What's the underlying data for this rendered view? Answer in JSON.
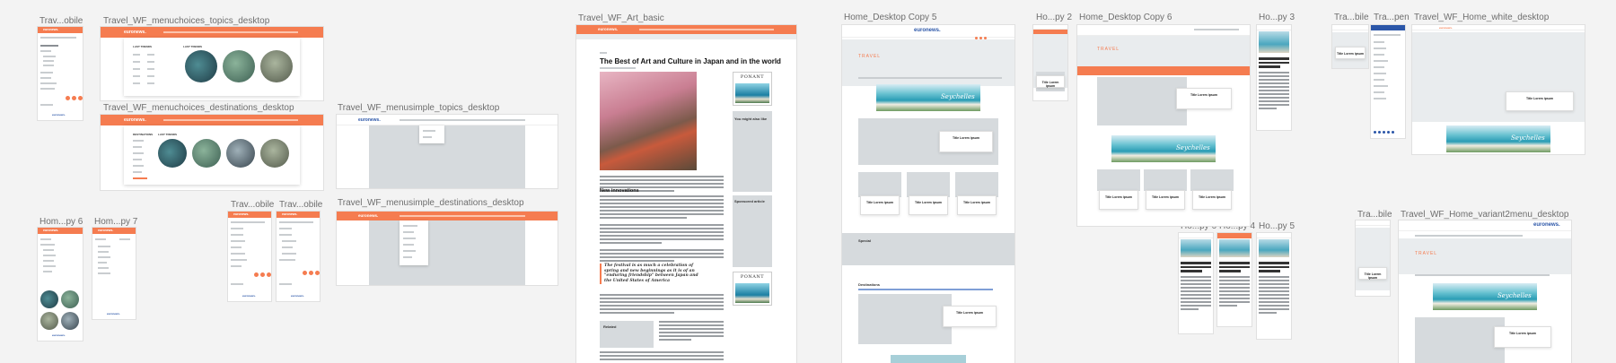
{
  "labels": [
    "Trav...obile",
    "Travel_WF_menuchoices_topics_desktop",
    "Travel_WF_menuchoices_destinations_desktop",
    "Travel_WF_menusimple_topics_desktop",
    "Travel_WF_menusimple_destinations_desktop",
    "Hom...py 6",
    "Hom...py 7",
    "Trav...obile",
    "Trav...obile",
    "Travel_WF_Art_basic",
    "Home_Desktop Copy 5",
    "Ho...py 2",
    "Home_Desktop Copy 6",
    "Ho...py 3",
    "Tra...bile",
    "Tra...pen",
    "Travel_WF_Home_white_desktop",
    "Ho...py 6",
    "Ho...py 4",
    "Ho...py 5",
    "Tra...bile",
    "Travel_WF_Home_variant2menu_desktop"
  ],
  "brand": {
    "name": "euronews.",
    "section": "TRAVEL",
    "accent": "#f57c50",
    "logo_blue": "#2b56a8"
  },
  "section_title": "TRAVEL",
  "menus": {
    "topics_header": "LAST TRENDS",
    "destinations_header": "DESTINATIONS",
    "latest": "LAST TRENDS",
    "circle_captions": [
      "EXPERIENCES",
      "SPORT",
      "BEAUTY",
      "ADVENTURE"
    ]
  },
  "article": {
    "title": "The Best of Art and Culture in Japan and in the world",
    "h_new": "New innovations",
    "quote": "The festival is as much a celebration of spring and new beginnings as it is of an \"enduring friendship\" between Japan and the United States of America",
    "related": "Related",
    "might_like": "You might also like",
    "sponsored": "Sponsored article",
    "ad_brand": "PONANT"
  },
  "cards": {
    "title": "Title Lorem ipsum"
  },
  "ad_banner": {
    "word": "Seychelles"
  },
  "special": "Special",
  "destinations": "Destinations"
}
